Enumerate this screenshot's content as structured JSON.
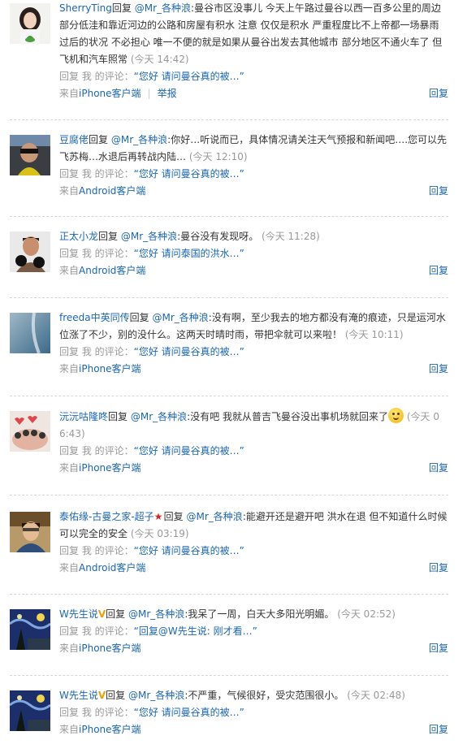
{
  "common": {
    "reply_prefix": "回复",
    "reply_my_comment": "回复 我 的评论：",
    "from": "来自",
    "reply_button": "回复",
    "report": "举报",
    "mention": "@Mr_各种浪"
  },
  "comments": [
    {
      "author": "SherryTing",
      "text": ":曼谷市区没事儿 今天上午路过曼谷以西一百多公里的周边 部分低洼和靠近河边的公路和房屋有积水 注意 仅仅是积水 严重程度比不上帝都一场暴雨过后的状况 不必担心 唯一不便的就是如果从曼谷出发去其他城市 部分地区不通火车了 但飞机和汽车照常",
      "time": "(今天 14:42)",
      "quote": "“您好 请问曼谷真的被…”",
      "source": "iPhone客户端",
      "has_report": true
    },
    {
      "author": "豆腐佬",
      "text": ":你好…听说而已，具体情况请关注天气预报和新闻吧….您可以先飞苏梅…水退后再转战内陆…",
      "time": "(今天 12:10)",
      "quote": "“您好 请问曼谷真的被…”",
      "source": "Android客户端"
    },
    {
      "author": "正太小龙",
      "text": ":曼谷没有发现呀。",
      "time": "(今天 11:28)",
      "quote": "“您好 请问泰国的洪水…”",
      "source": "Android客户端"
    },
    {
      "author": "freeda中英同传",
      "text": ":没有啊，至少我去的地方都没有淹的痕迹，只是运河水位涨了不少，别的没什么。这两天时晴时雨，带把伞就可以来啦！",
      "time": "(今天 10:11)",
      "quote": "“您好 请问曼谷真的被…”",
      "source": "iPhone客户端"
    },
    {
      "author": "沅沅咕隆咚",
      "text": ":没有吧 我就从普吉飞曼谷没出事机场就回来了",
      "time": "(今天 06:43)",
      "quote": "“您好 请问曼谷真的被…”",
      "source": "iPhone客户端"
    },
    {
      "author": "泰佑缘-古曼之家-超子",
      "text": ":能避开还是避开吧 洪水在退 但不知道什么时候可以完全的安全",
      "time": "(今天 03:19)",
      "quote": "“您好 请问曼谷真的被…”",
      "source": "Android客户端"
    },
    {
      "author": "W先生说",
      "text": ":我呆了一周，白天大多阳光明媚。",
      "time": "(今天 02:52)",
      "quote": "“回复@W先生说: 刚才看…”",
      "source": "iPhone客户端"
    },
    {
      "author": "W先生说",
      "text": ":不严重，气候很好，受灾范围很小。",
      "time": "(今天 02:48)",
      "quote": "“您好 请问曼谷真的被…”",
      "source": "iPhone客户端"
    }
  ]
}
